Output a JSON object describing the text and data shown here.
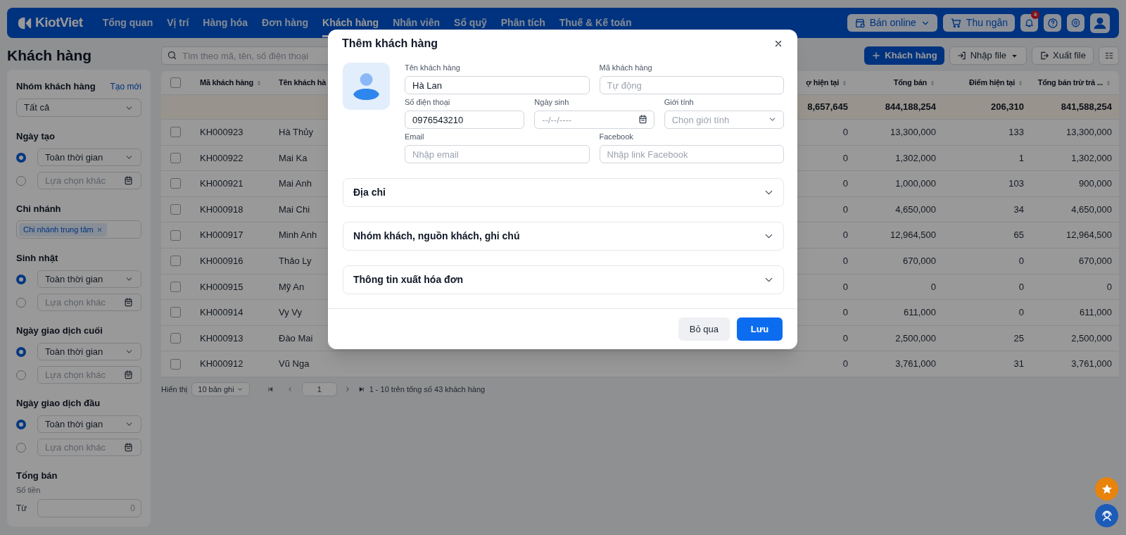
{
  "nav": {
    "logo": "KiotViet",
    "items": [
      {
        "label": "Tổng quan",
        "selected": false
      },
      {
        "label": "Vị trí",
        "selected": false
      },
      {
        "label": "Hàng hóa",
        "selected": false
      },
      {
        "label": "Đơn hàng",
        "selected": false
      },
      {
        "label": "Khách hàng",
        "selected": true
      },
      {
        "label": "Nhân viên",
        "selected": false
      },
      {
        "label": "Sổ quỹ",
        "selected": false
      },
      {
        "label": "Phân tích",
        "selected": false
      },
      {
        "label": "Thuế & Kế toán",
        "selected": false
      }
    ],
    "online_button": "Bán online",
    "cashier_button": "Thu ngân",
    "notification_count": "4"
  },
  "page_title": "Khách hàng",
  "search": {
    "placeholder": "Tìm theo mã, tên, số điện thoại"
  },
  "toolbar": {
    "add_button": "Khách hàng",
    "import_button": "Nhập file",
    "export_button": "Xuất file"
  },
  "sidebar": {
    "groups": [
      {
        "kind": "select",
        "title": "Nhóm khách hàng",
        "link": "Tạo mới",
        "value": "Tất cả"
      },
      {
        "kind": "period",
        "title": "Ngày tạo",
        "options": [
          {
            "kind": "select",
            "text": "Toàn thời gian",
            "selected": true
          },
          {
            "kind": "date",
            "placeholder": "Lựa chọn khác",
            "selected": false
          }
        ]
      },
      {
        "kind": "tags",
        "title": "Chi nhánh",
        "tags": [
          "Chi nhánh trung tâm"
        ]
      },
      {
        "kind": "period",
        "title": "Sinh nhật",
        "options": [
          {
            "kind": "select",
            "text": "Toàn thời gian",
            "selected": true
          },
          {
            "kind": "date",
            "placeholder": "Lựa chọn khác",
            "selected": false
          }
        ]
      },
      {
        "kind": "period",
        "title": "Ngày giao dịch cuối",
        "options": [
          {
            "kind": "select",
            "text": "Toàn thời gian",
            "selected": true
          },
          {
            "kind": "date",
            "placeholder": "Lựa chọn khác",
            "selected": false
          }
        ]
      },
      {
        "kind": "period",
        "title": "Ngày giao dịch đầu",
        "options": [
          {
            "kind": "select",
            "text": "Toàn thời gian",
            "selected": true
          },
          {
            "kind": "date",
            "placeholder": "Lựa chọn khác",
            "selected": false
          }
        ]
      },
      {
        "kind": "range",
        "title": "Tổng bán",
        "sublabel": "Số tiền",
        "from_label": "Từ",
        "from_placeholder": "0"
      }
    ]
  },
  "table": {
    "all_checked": false,
    "columns": [
      {
        "label": "Mã khách hàng",
        "kind": "text",
        "sortable": true
      },
      {
        "label": "Tên khách hà",
        "kind": "text",
        "sortable": false
      },
      {
        "label": "ợ hiện tại",
        "kind": "number",
        "sortable": true
      },
      {
        "label": "Tổng bán",
        "kind": "number",
        "sortable": true
      },
      {
        "label": "Điểm hiện tại",
        "kind": "number",
        "sortable": true
      },
      {
        "label": "Tổng bán trừ trả ...",
        "kind": "number",
        "sortable": true
      }
    ],
    "summary": [
      "8,657,645",
      "844,188,254",
      "206,310",
      "841,588,254"
    ],
    "rows": [
      {
        "checked": false,
        "cells": [
          "KH000923",
          "Hà Thủy",
          "0",
          "13,300,000",
          "133",
          "13,300,000"
        ]
      },
      {
        "checked": false,
        "cells": [
          "KH000922",
          "Mai Ka",
          "0",
          "1,302,000",
          "1",
          "1,302,000"
        ]
      },
      {
        "checked": false,
        "cells": [
          "KH000921",
          "Mai Anh",
          "0",
          "1,000,000",
          "103",
          "900,000"
        ]
      },
      {
        "checked": false,
        "cells": [
          "KH000918",
          "Mai Chi",
          "0",
          "4,650,000",
          "34",
          "4,650,000"
        ]
      },
      {
        "checked": false,
        "cells": [
          "KH000917",
          "Minh Anh",
          "0",
          "12,964,500",
          "65",
          "12,964,500"
        ]
      },
      {
        "checked": false,
        "cells": [
          "KH000916",
          "Thảo Ly",
          "0",
          "670,000",
          "0",
          "670,000"
        ]
      },
      {
        "checked": false,
        "cells": [
          "KH000915",
          "Mỹ An",
          "0",
          "0",
          "0",
          "0"
        ]
      },
      {
        "checked": false,
        "cells": [
          "KH000914",
          "Vy Vy",
          "0",
          "611,000",
          "0",
          "611,000"
        ]
      },
      {
        "checked": false,
        "cells": [
          "KH000913",
          "Đào Mai",
          "0",
          "2,500,000",
          "25",
          "2,500,000"
        ]
      },
      {
        "checked": false,
        "cells": [
          "KH000912",
          "Vũ Nga",
          "0",
          "3,761,000",
          "31",
          "3,761,000"
        ]
      }
    ]
  },
  "pagination": {
    "label": "Hiển thị",
    "page_size": "10 bản ghi",
    "page": "1",
    "summary": "1 - 10 trên tổng số 43 khách hàng"
  },
  "dialog": {
    "title": "Thêm khách hàng",
    "field_rows": [
      [
        {
          "label": "Tên khách hàng",
          "kind": "text",
          "value": "Hà Lan"
        },
        {
          "label": "Mã khách hàng",
          "kind": "text",
          "placeholder": "Tự động"
        }
      ],
      [
        {
          "label": "Số điện thoại",
          "kind": "text",
          "value": "0976543210"
        },
        {
          "label": "Ngày sinh",
          "kind": "date",
          "placeholder": "--/--/----"
        },
        {
          "label": "Giới tính",
          "kind": "select",
          "placeholder": "Chọn giới tính"
        }
      ],
      [
        {
          "label": "Email",
          "kind": "text",
          "placeholder": "Nhập email"
        },
        {
          "label": "Facebook",
          "kind": "text",
          "placeholder": "Nhập link Facebook"
        }
      ]
    ],
    "sections": [
      {
        "title": "Địa chỉ",
        "expanded": false
      },
      {
        "title": "Nhóm khách, nguồn khách, ghi chú",
        "expanded": false
      },
      {
        "title": "Thông tin xuất hóa đơn",
        "expanded": false
      }
    ],
    "cancel_button": "Bỏ qua",
    "save_button": "Lưu"
  }
}
